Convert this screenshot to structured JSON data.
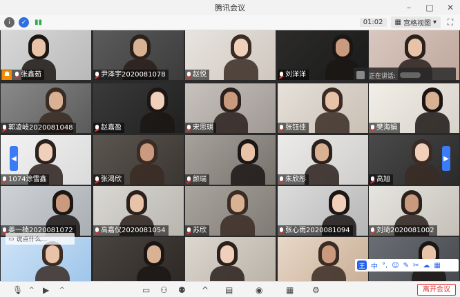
{
  "window": {
    "title": "腾讯会议"
  },
  "toolbar": {
    "timer": "01:02",
    "view_label": "宫格视图"
  },
  "speaking": {
    "label": "正在讲话:"
  },
  "input_hint": {
    "placeholder": "说点什么..."
  },
  "ime": {
    "label": "王",
    "items": [
      "中",
      "°,",
      "☺",
      "✎",
      "✂",
      "☁",
      "▦"
    ]
  },
  "bottom": {
    "leave_label": "离开会议"
  },
  "colors": {
    "accent": "#3b7cf6",
    "danger": "#e03131",
    "host": "#f08c00"
  },
  "participants": [
    {
      "name": "张鑫茹",
      "host": true
    },
    {
      "name": "尹泽宇2020081078"
    },
    {
      "name": "赵悦"
    },
    {
      "name": "刘洋洋"
    },
    {
      "name": ""
    },
    {
      "name": "郭凌岐2020081048"
    },
    {
      "name": "赵嘉盈"
    },
    {
      "name": "宋思琪"
    },
    {
      "name": "张钰佳"
    },
    {
      "name": "樊海娟"
    },
    {
      "name": "1074涂雪鑫"
    },
    {
      "name": "张渴欣"
    },
    {
      "name": "颜瑞"
    },
    {
      "name": "朱欣彤"
    },
    {
      "name": "高旭"
    },
    {
      "name": "姜一楠2020081072"
    },
    {
      "name": "高嘉仪2020081054"
    },
    {
      "name": "苏欣"
    },
    {
      "name": "张心雨2020081094"
    },
    {
      "name": "刘琦2020081002"
    }
  ]
}
